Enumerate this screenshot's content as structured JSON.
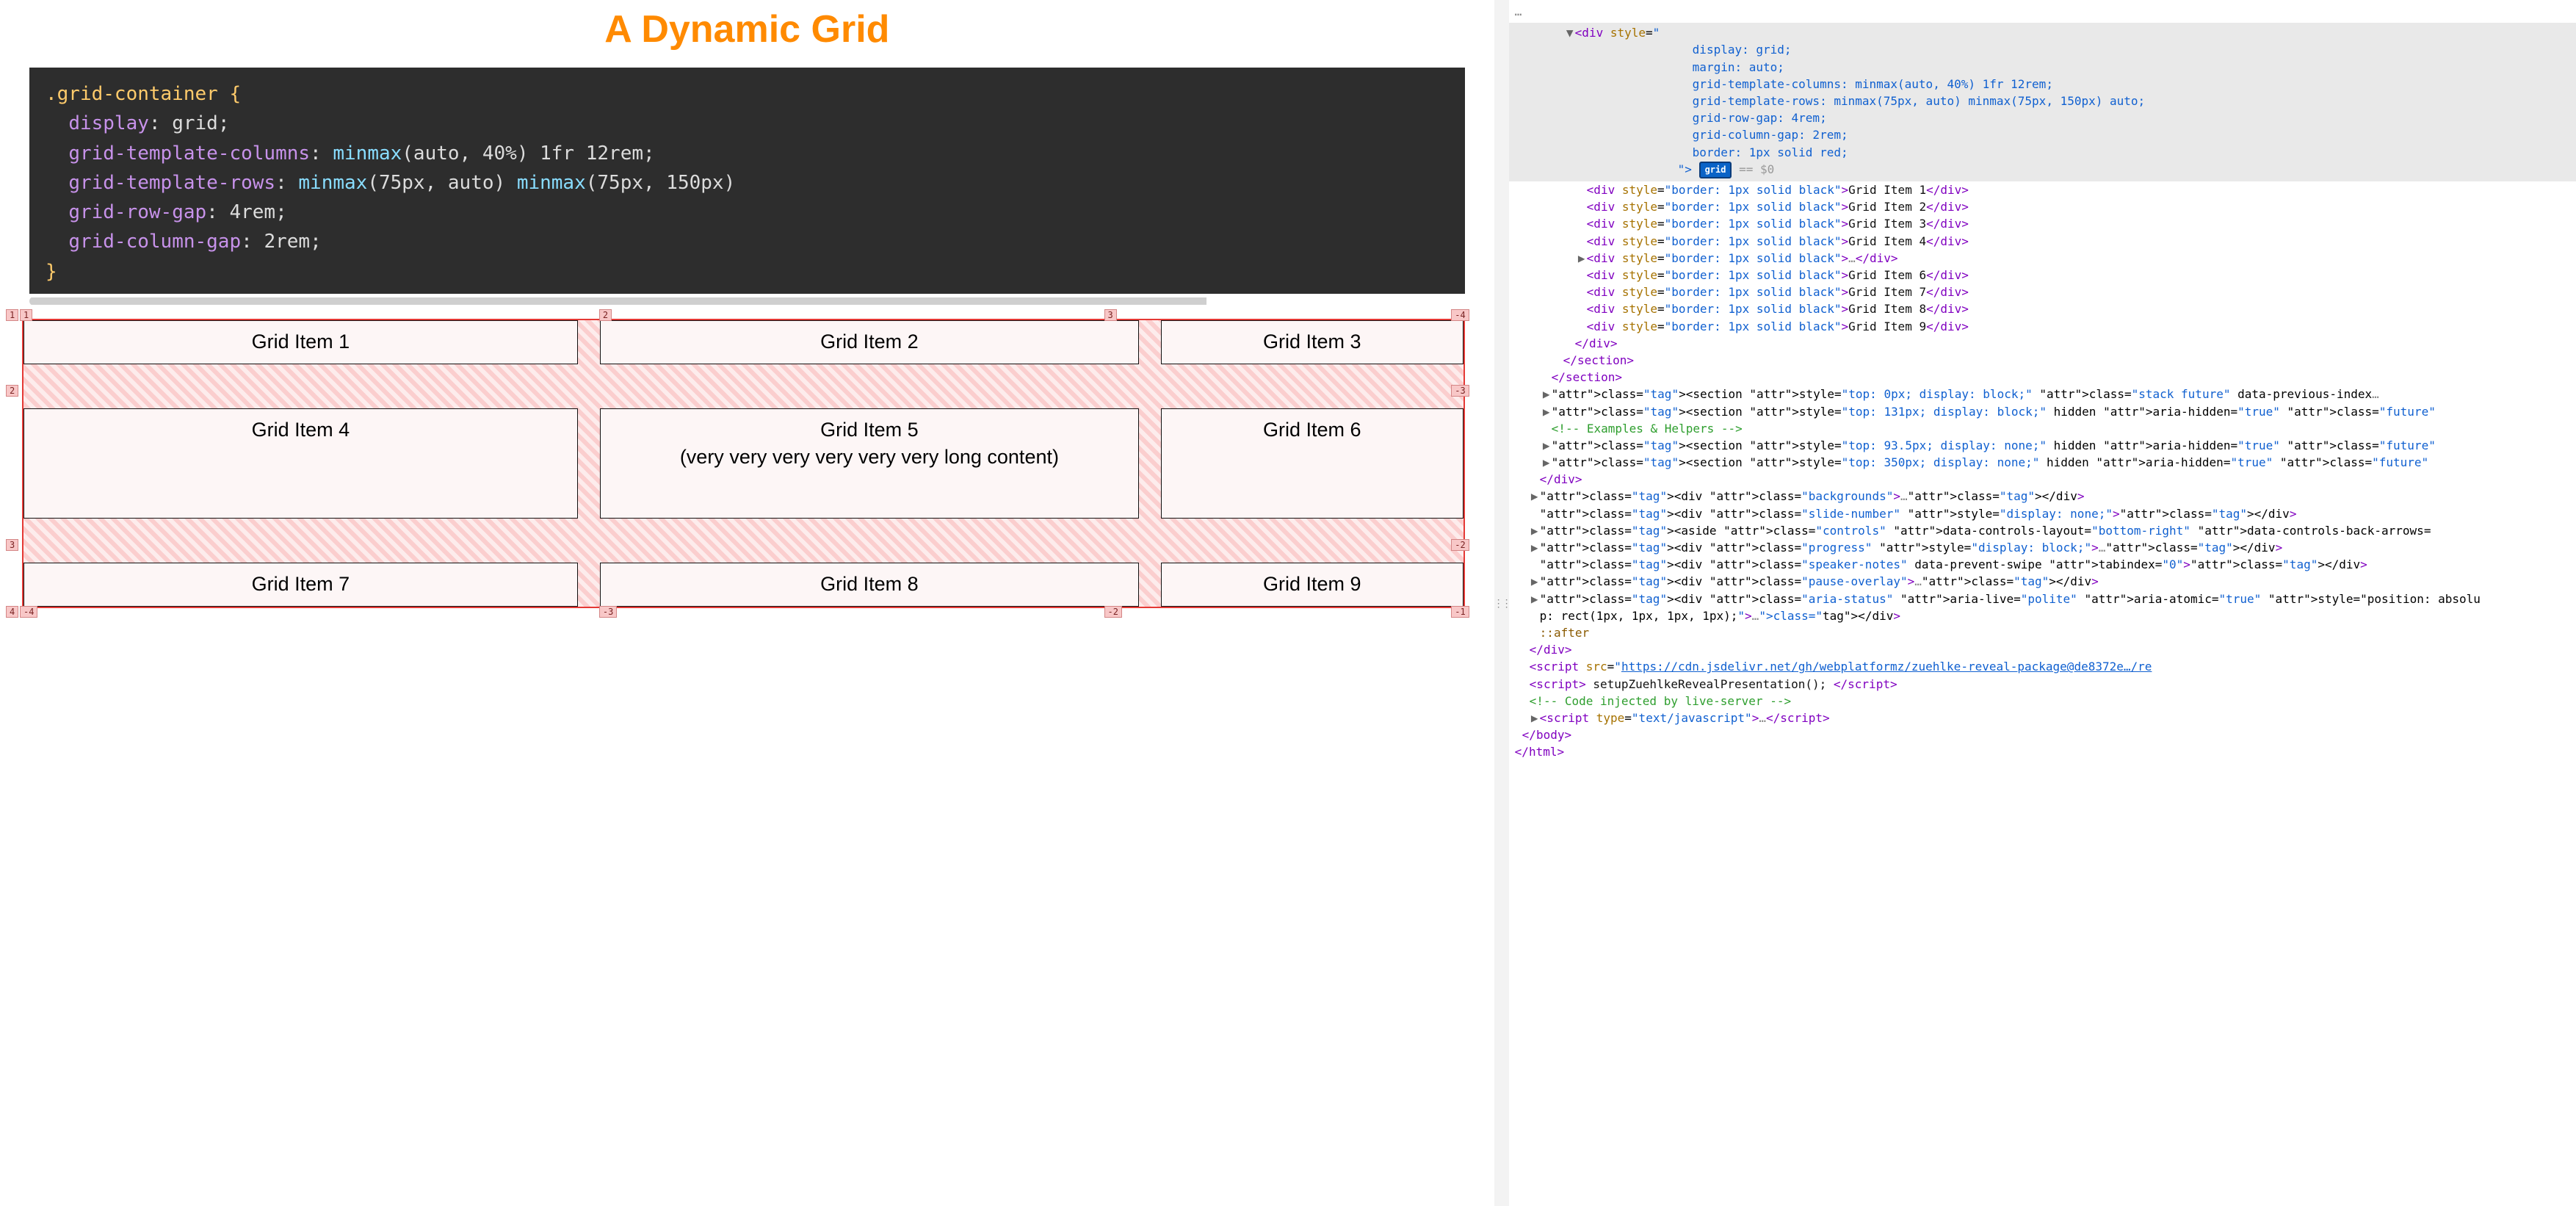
{
  "slide": {
    "title": "A Dynamic Grid",
    "code": {
      "selector": ".grid-container {",
      "props": [
        {
          "prop": "display",
          "val": "grid"
        },
        {
          "prop": "grid-template-columns",
          "val_fn1": "minmax",
          "val_args1": "(auto, 40%)",
          "val_rest": " 1fr 12rem"
        },
        {
          "prop": "grid-template-rows",
          "val_fn1": "minmax",
          "val_args1": "(75px, auto)",
          "val_fn2": "minmax",
          "val_args2": "(75px, 150px)"
        },
        {
          "prop": "grid-row-gap",
          "val": "4rem"
        },
        {
          "prop": "grid-column-gap",
          "val": "2rem"
        }
      ],
      "close": "}"
    },
    "gridItems": [
      "Grid Item 1",
      "Grid Item 2",
      "Grid Item 3",
      "Grid Item 4",
      "Grid Item 5\n(very very very very very very long content)",
      "Grid Item 6",
      "Grid Item 7",
      "Grid Item 8",
      "Grid Item 9"
    ],
    "lineBadges": {
      "topLeftPair": [
        "1",
        "1"
      ],
      "col2": "2",
      "col3": "3",
      "topRight": "-4",
      "row2Left": "2",
      "row2Right": "-3",
      "row3Left": "3",
      "row3Right": "-2",
      "bottomLeftPair": [
        "4",
        "-4"
      ],
      "bottomCol2": "-3",
      "bottomCol3": "-2",
      "bottomRight": "-1"
    }
  },
  "devtools": {
    "ellipsis": "…",
    "selectedDiv_open": "<div style=\"",
    "selectedDiv_styleLines": [
      "display: grid;",
      "margin: auto;",
      "grid-template-columns: minmax(auto, 40%) 1fr 12rem;",
      "grid-template-rows: minmax(75px, auto) minmax(75px, 150px) auto;",
      "grid-row-gap: 4rem;",
      "grid-column-gap: 2rem;",
      "border: 1px solid red;"
    ],
    "selectedDiv_closeAttr": "\">",
    "gridBadge": "grid",
    "eq0": " == $0",
    "childItems": [
      {
        "text": "Grid Item 1"
      },
      {
        "text": "Grid Item 2"
      },
      {
        "text": "Grid Item 3"
      },
      {
        "text": "Grid Item 4"
      },
      {
        "collapsed": true
      },
      {
        "text": "Grid Item 6"
      },
      {
        "text": "Grid Item 7"
      },
      {
        "text": "Grid Item 8"
      },
      {
        "text": "Grid Item 9"
      }
    ],
    "closingDiv": "</div>",
    "closingSection1": "</section>",
    "closingSection2": "</section>",
    "afterSections": [
      {
        "arrow": true,
        "html": "<section style=\"top: 0px; display: block;\" class=\"stack future\" data-previous-index…"
      },
      {
        "arrow": true,
        "html": "<section style=\"top: 131px; display: block;\" hidden aria-hidden=\"true\" class=\"future\""
      },
      {
        "comment": "<!-- Examples & Helpers -->"
      },
      {
        "arrow": true,
        "html": "<section style=\"top: 93.5px; display: none;\" hidden aria-hidden=\"true\" class=\"future\""
      },
      {
        "arrow": true,
        "html": "<section style=\"top: 350px; display: none;\" hidden aria-hidden=\"true\" class=\"future\""
      }
    ],
    "closingDiv2": "</div>",
    "miscDivs": [
      {
        "arrow": true,
        "html": "<div class=\"backgrounds\">…</div>"
      },
      {
        "arrow": false,
        "html": "<div class=\"slide-number\" style=\"display: none;\"></div>"
      },
      {
        "arrow": true,
        "html": "<aside class=\"controls\" data-controls-layout=\"bottom-right\" data-controls-back-arrows="
      },
      {
        "arrow": true,
        "html": "<div class=\"progress\" style=\"display: block;\">…</div>"
      },
      {
        "arrow": false,
        "html": "<div class=\"speaker-notes\" data-prevent-swipe tabindex=\"0\"></div>"
      },
      {
        "arrow": true,
        "html": "<div class=\"pause-overlay\">…</div>"
      },
      {
        "arrow": true,
        "html": "<div class=\"aria-status\" aria-live=\"polite\" aria-atomic=\"true\" style=\"position: absolu"
      },
      {
        "plain": "p: rect(1px, 1px, 1px, 1px);\">…</div>"
      },
      {
        "pseudo": "::after"
      }
    ],
    "closingDiv3": "</div>",
    "scriptSrc_label": "<script src=\"",
    "scriptSrc_href": "https://cdn.jsdelivr.net/gh/webplatformz/zuehlke-reveal-package@de8372e…/re",
    "scriptInline": "<script> setupZuehlkeRevealPresentation(); </script>",
    "liveServerComment": "<!-- Code injected by live-server -->",
    "scriptTypeJs": "<script type=\"text/javascript\">…</script>",
    "closeBody": "</body>",
    "closeHtml": "</html>"
  }
}
